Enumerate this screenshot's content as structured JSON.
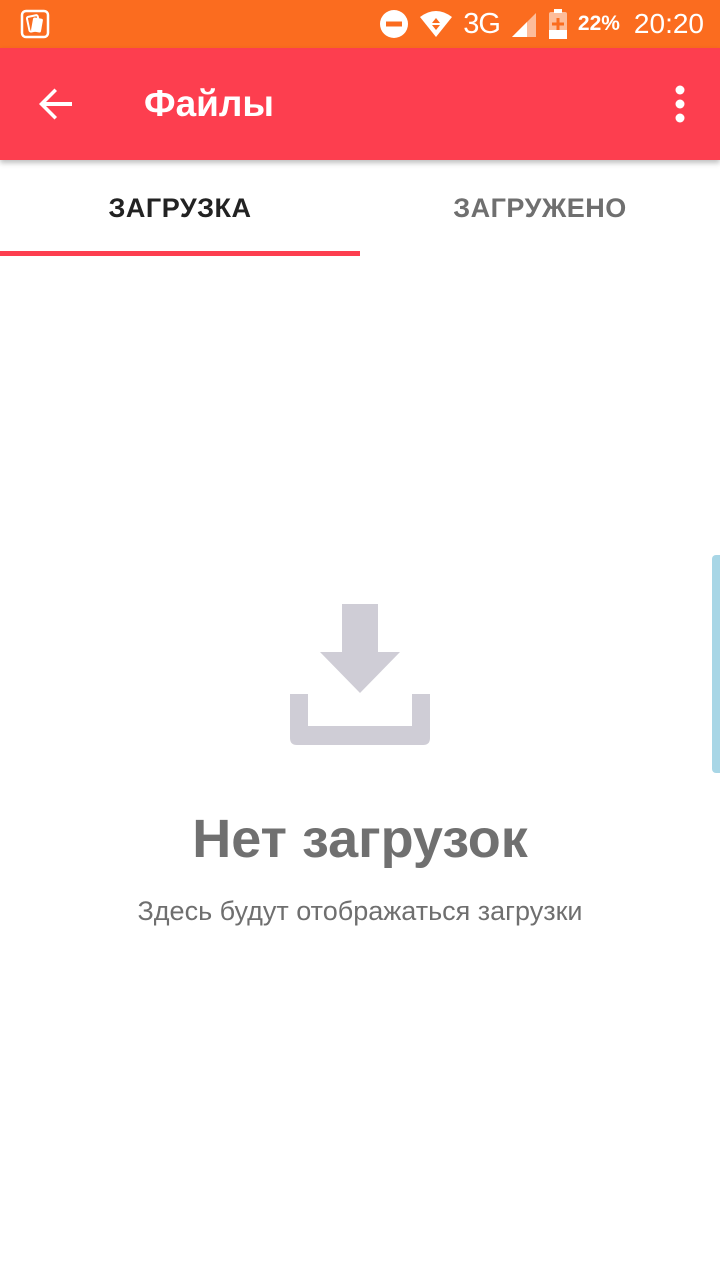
{
  "status_bar": {
    "left_icon": "notification-app-icon",
    "network_type": "3G",
    "battery_percent": "22%",
    "time": "20:20",
    "background_color": "#fb6c1f"
  },
  "app_bar": {
    "title": "Файлы",
    "back_icon": "arrow-back-icon",
    "menu_icon": "more-vert-icon",
    "background_color": "#fd3e4f"
  },
  "tabs": [
    {
      "label": "ЗАГРУЗКА",
      "active": true
    },
    {
      "label": "ЗАГРУЖЕНО",
      "active": false
    }
  ],
  "empty_state": {
    "icon": "download-icon",
    "title": "Нет загрузок",
    "subtitle": "Здесь будут отображаться загрузки"
  }
}
